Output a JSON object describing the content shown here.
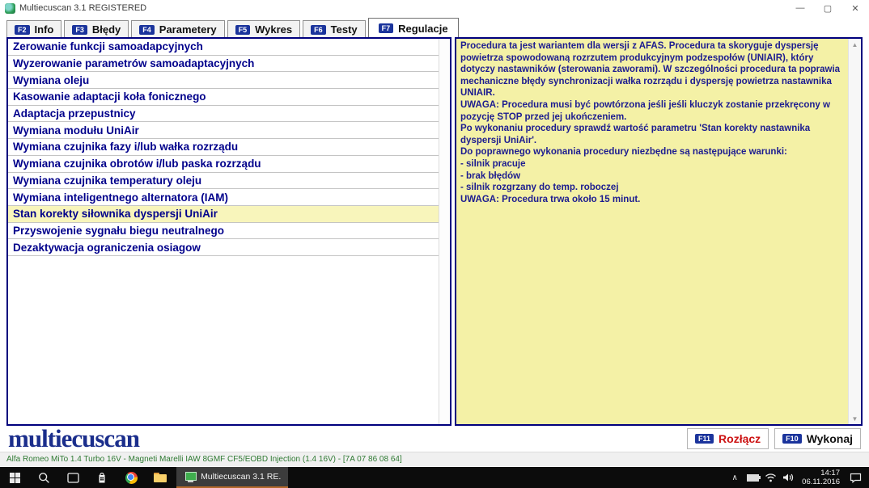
{
  "window": {
    "title": "Multiecuscan 3.1 REGISTERED",
    "controls": {
      "minimize": "—",
      "maximize": "▢",
      "close": "✕"
    }
  },
  "tabs": [
    {
      "key": "F2",
      "label": "Info",
      "active": false
    },
    {
      "key": "F3",
      "label": "Błędy",
      "active": false
    },
    {
      "key": "F4",
      "label": "Parametery",
      "active": false
    },
    {
      "key": "F5",
      "label": "Wykres",
      "active": false
    },
    {
      "key": "F6",
      "label": "Testy",
      "active": false
    },
    {
      "key": "F7",
      "label": "Regulacje",
      "active": true
    }
  ],
  "procedures": {
    "selected_index": 10,
    "items": [
      "Zerowanie funkcji samoadapcyjnych",
      "Wyzerowanie parametrów samoadaptacyjnych",
      "Wymiana oleju",
      "Kasowanie adaptacji koła fonicznego",
      "Adaptacja przepustnicy",
      "Wymiana modułu UniAir",
      "Wymiana czujnika fazy i/lub wałka rozrządu",
      "Wymiana czujnika obrotów i/lub paska rozrządu",
      "Wymiana czujnika temperatury oleju",
      "Wymiana inteligentnego alternatora (IAM)",
      "Stan korekty siłownika dyspersji UniAir",
      "Przyswojenie sygnału biegu neutralnego",
      "Dezaktywacja ograniczenia osiagow"
    ]
  },
  "description_lines": [
    "Procedura ta jest wariantem dla wersji z AFAS. Procedura ta skoryguje dyspersję powietrza spowodowaną rozrzutem produkcyjnym podzespołów (UNIAIR), który dotyczy nastawników (sterowania zaworami). W szczególności procedura ta poprawia mechaniczne błędy synchronizacji wałka rozrządu i dyspersję powietrza nastawnika UNIAIR.",
    "UWAGA: Procedura musi być powtórzona jeśli jeśli kluczyk zostanie przekręcony w pozycję STOP przed jej ukończeniem.",
    "Po wykonaniu procedury sprawdź wartość parametru 'Stan korekty nastawnika dyspersji UniAir'.",
    "Do poprawnego wykonania procedury niezbędne są następujące warunki:",
    "- silnik pracuje",
    "- brak błędów",
    "- silnik rozgrzany do temp. roboczej",
    "UWAGA: Procedura trwa około 15 minut."
  ],
  "logo": "multiecuscan",
  "buttons": {
    "disconnect": {
      "key": "F11",
      "label": "Rozłącz"
    },
    "execute": {
      "key": "F10",
      "label": "Wykonaj"
    }
  },
  "status": "Alfa Romeo MiTo 1.4 Turbo 16V - Magneti Marelli IAW 8GMF CF5/EOBD Injection (1.4 16V) - [7A 07 86 08 64]",
  "taskbar": {
    "app_label": "Multiecuscan 3.1 RE...",
    "time": "14:17",
    "date": "06.11.2016"
  },
  "icons": {
    "scroll_up": "▲",
    "scroll_down": "▼",
    "tray_chevron": "∧"
  },
  "colors": {
    "navy_text": "#00008b",
    "panel_yellow": "#f4f1a6",
    "selected_row": "#f8f5bb",
    "badge_blue": "#1b349c",
    "status_green": "#2f7a33",
    "disconnect_red": "#cc1111",
    "taskbar_accent": "#b3682a"
  }
}
